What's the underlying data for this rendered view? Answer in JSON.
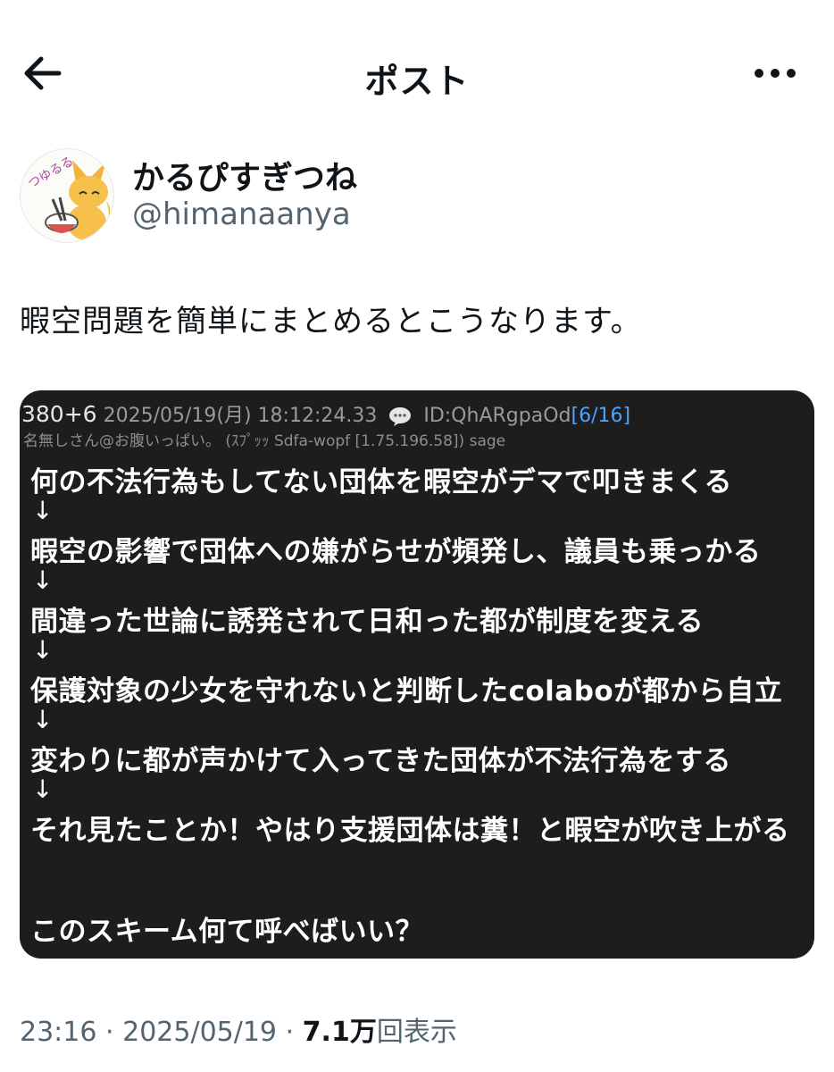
{
  "header": {
    "title": "ポスト",
    "back_icon": "arrow-left-icon",
    "more_icon": "more-dots-icon"
  },
  "author": {
    "display_name": "かるぴすぎつね",
    "handle": "@himanaanya",
    "avatar_text": "つゆるる"
  },
  "post": {
    "text": "暇空問題を簡単にまとめるとこうなります。"
  },
  "image": {
    "post_number": "380+6",
    "date": "2025/05/19(月) 18:12:24.33",
    "id_text": "ID:QhARgpaOd",
    "id_count": "[6/16]",
    "name_line": "名無しさん@お腹いっぱい。 (ｽﾌﾟｯｯ Sdfa-wopf [1.75.196.58]) sage",
    "lines": [
      "何の不法行為もしてない団体を暇空がデマで叩きまくる",
      "暇空の影響で団体への嫌がらせが頻発し、議員も乗っかる",
      "間違った世論に誘発されて日和った都が制度を変える",
      "保護対象の少女を守れないと判断したcolaboが都から自立",
      "変わりに都が声かけて入ってきた団体が不法行為をする",
      "それ見たことか！やはり支援団体は糞！と暇空が吹き上がる"
    ],
    "arrow": "↓",
    "question": "このスキーム何て呼べばいい？"
  },
  "meta": {
    "time": "23:16",
    "sep1": "·",
    "date": "2025/05/19",
    "sep2": "·",
    "views_count": "7.1万",
    "views_label": "回表示"
  }
}
